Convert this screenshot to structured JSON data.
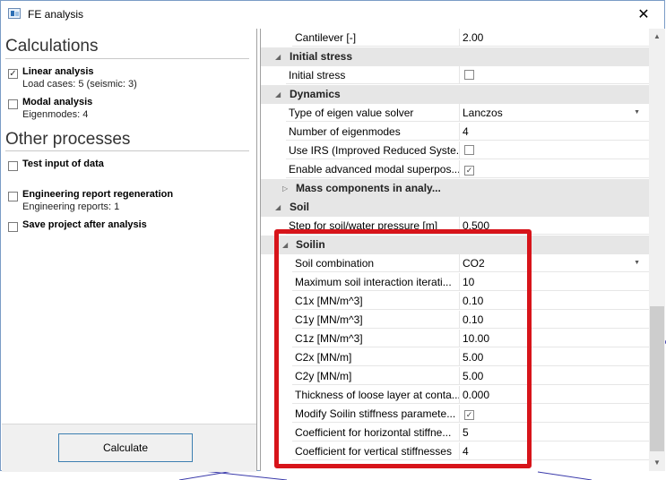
{
  "window": {
    "title": "FE analysis"
  },
  "left": {
    "calculations_title": "Calculations",
    "other_title": "Other processes",
    "calculations": [
      {
        "label": "Linear analysis",
        "sub": "Load cases: 5 (seismic: 3)",
        "checked": true
      },
      {
        "label": "Modal analysis",
        "sub": "Eigenmodes: 4",
        "checked": false
      }
    ],
    "others": [
      {
        "label": "Test input of data",
        "sub": "",
        "checked": false
      },
      {
        "label": "Engineering report regeneration",
        "sub": "Engineering reports: 1",
        "checked": false
      },
      {
        "label": "Save project after analysis",
        "sub": "",
        "checked": false
      }
    ],
    "calculate_label": "Calculate"
  },
  "grid": {
    "rows": [
      {
        "kind": "prop",
        "name": "Cantilever [-]",
        "value": "2.00",
        "indent": 1
      },
      {
        "kind": "group",
        "name": "Initial stress",
        "expanded": true,
        "indent": 0
      },
      {
        "kind": "prop",
        "name": "Initial stress",
        "value": "",
        "checkbox": true,
        "checked": false,
        "indent": 0
      },
      {
        "kind": "group",
        "name": "Dynamics",
        "expanded": true,
        "indent": 0
      },
      {
        "kind": "prop",
        "name": "Type of eigen value solver",
        "value": "Lanczos",
        "dropdown": true,
        "indent": 0
      },
      {
        "kind": "prop",
        "name": "Number of eigenmodes",
        "value": "4",
        "indent": 0
      },
      {
        "kind": "prop",
        "name": "Use IRS (Improved Reduced Syste...",
        "value": "",
        "checkbox": true,
        "checked": false,
        "indent": 0
      },
      {
        "kind": "prop",
        "name": "Enable advanced modal superpos...",
        "value": "",
        "checkbox": true,
        "checked": true,
        "indent": 0
      },
      {
        "kind": "group",
        "name": "Mass components in analy...",
        "expanded": false,
        "indent": 1
      },
      {
        "kind": "group",
        "name": "Soil",
        "expanded": true,
        "indent": 0
      },
      {
        "kind": "prop",
        "name": "Step for soil/water pressure [m]",
        "value": "0.500",
        "indent": 0
      },
      {
        "kind": "group",
        "name": "Soilin",
        "expanded": true,
        "indent": 1
      },
      {
        "kind": "prop",
        "name": "Soil combination",
        "value": "CO2",
        "dropdown": true,
        "indent": 1
      },
      {
        "kind": "prop",
        "name": "Maximum soil interaction iterati...",
        "value": "10",
        "indent": 1
      },
      {
        "kind": "prop",
        "name": "C1x [MN/m^3]",
        "value": "0.10",
        "indent": 1
      },
      {
        "kind": "prop",
        "name": "C1y [MN/m^3]",
        "value": "0.10",
        "indent": 1
      },
      {
        "kind": "prop",
        "name": "C1z [MN/m^3]",
        "value": "10.00",
        "indent": 1
      },
      {
        "kind": "prop",
        "name": "C2x [MN/m]",
        "value": "5.00",
        "indent": 1
      },
      {
        "kind": "prop",
        "name": "C2y [MN/m]",
        "value": "5.00",
        "indent": 1
      },
      {
        "kind": "prop",
        "name": "Thickness of loose layer at conta...",
        "value": "0.000",
        "indent": 1
      },
      {
        "kind": "prop",
        "name": "Modify Soilin stiffness paramete...",
        "value": "",
        "checkbox": true,
        "checked": true,
        "indent": 1
      },
      {
        "kind": "prop",
        "name": "Coefficient for horizontal stiffne...",
        "value": "5",
        "indent": 1
      },
      {
        "kind": "prop",
        "name": "Coefficient for vertical stiffnesses",
        "value": "4",
        "indent": 1
      }
    ]
  },
  "icons": {
    "close": "close-icon",
    "app": "fe-analysis-app-icon",
    "checkbox": "checkbox-icon",
    "expand": "triangle-expand-icon",
    "collapsed": "triangle-collapsed-icon",
    "dropdown": "chevron-down-icon"
  },
  "colors": {
    "highlight": "#d7141a",
    "group_bg": "#e6e6e6",
    "button_border": "#3c7fb1"
  }
}
